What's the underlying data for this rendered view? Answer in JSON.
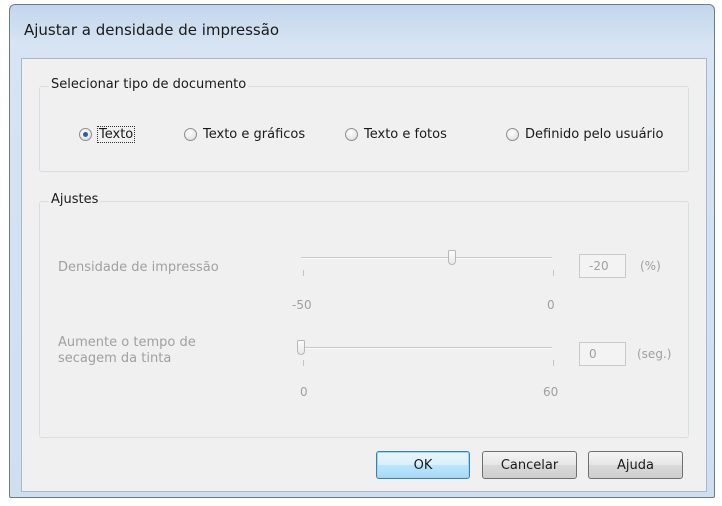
{
  "window": {
    "title": "Ajustar a densidade de impressão"
  },
  "document_type": {
    "group_label": "Selecionar tipo de documento",
    "options": [
      {
        "label": "Texto",
        "selected": true
      },
      {
        "label": "Texto e gráficos",
        "selected": false
      },
      {
        "label": "Texto e fotos",
        "selected": false
      },
      {
        "label": "Definido pelo usuário",
        "selected": false
      }
    ]
  },
  "adjustments": {
    "group_label": "Ajustes",
    "density": {
      "label": "Densidade de impressão",
      "min_label": "-50",
      "max_label": "0",
      "min": -50,
      "max": 0,
      "value": "-20",
      "unit": "(%)",
      "enabled": false
    },
    "drying": {
      "label_line1": "Aumente o tempo de",
      "label_line2": "secagem da tinta",
      "min_label": "0",
      "max_label": "60",
      "min": 0,
      "max": 60,
      "value": "0",
      "unit": "(seg.)",
      "enabled": false
    }
  },
  "buttons": {
    "ok": "OK",
    "cancel": "Cancelar",
    "help": "Ajuda"
  }
}
